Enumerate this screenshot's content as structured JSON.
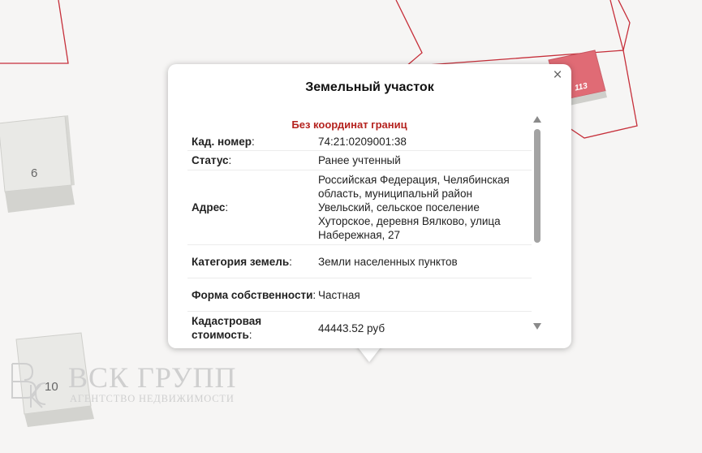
{
  "map": {
    "buildings": [
      {
        "label": "6"
      },
      {
        "label": "113"
      },
      {
        "label": "10"
      }
    ]
  },
  "popup": {
    "title": "Земельный участок",
    "close_symbol": "×",
    "subtitle": "Без координат границ",
    "rows": [
      {
        "key": "Кад. номер",
        "value": "74:21:0209001:38"
      },
      {
        "key": "Статус",
        "value": "Ранее учтенный"
      },
      {
        "key": "Адрес",
        "value": "Российская Федерация, Челябинская область, муниципальнй район Увельский, сельское поселение Хуторское, деревня Вялково, улица Набережная, 27"
      },
      {
        "key": "Категория земель",
        "value": "Земли населенных пунктов"
      },
      {
        "key": "Форма собственности",
        "value": "Частная"
      },
      {
        "key": "Кадастровая стоимость",
        "value": "44443.52 руб"
      }
    ]
  },
  "watermark": {
    "title": "ВСК ГРУПП",
    "subtitle": "АГЕНТСТВО НЕДВИЖИМОСТИ"
  },
  "colors": {
    "parcel_border": "#c62f3a",
    "subtitle": "#b5231f",
    "highlight_building": "#e06b75"
  }
}
